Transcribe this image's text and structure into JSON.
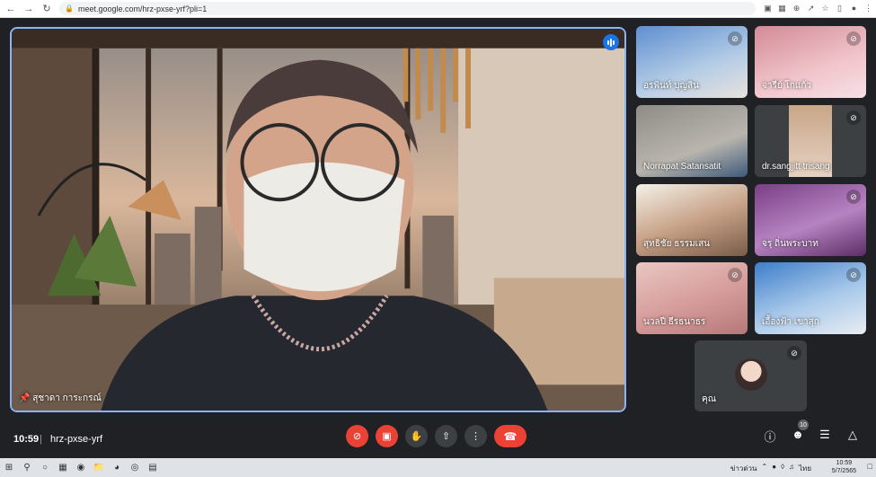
{
  "browser": {
    "url": "meet.google.com/hrz-pxse-yrf?pli=1",
    "back_icon": "arrow-left-icon",
    "forward_icon": "arrow-right-icon",
    "reload_icon": "reload-icon"
  },
  "main_speaker": {
    "name": "สุชาดา การะกรณ์"
  },
  "participants": [
    {
      "name": "อรพินท์ บุญสิน",
      "muted": true
    },
    {
      "name": "จารีย์ โกแก้ว",
      "muted": true
    },
    {
      "name": "Norrapat Satansatit",
      "muted": false
    },
    {
      "name": "dr.sangjitt trisang",
      "muted": true
    },
    {
      "name": "สุทธิชัย ธรรมเสน",
      "muted": false
    },
    {
      "name": "จรุ ถิ่นพระบาท",
      "muted": true
    },
    {
      "name": "นวลปี ธีรธนาธร",
      "muted": true
    },
    {
      "name": "เอื้องฟ้า เขาสุก",
      "muted": true
    }
  ],
  "self_tile": {
    "name": "คุณ",
    "muted": true
  },
  "bottom_bar": {
    "time": "10:59",
    "separator": "|",
    "meeting_code": "hrz-pxse-yrf",
    "participant_count": "10"
  },
  "taskbar": {
    "language": "ไทย",
    "weather": "ข่าวด่วน",
    "time": "10:59",
    "date": "5/7/2565"
  },
  "colors": {
    "accent": "#8ab4f8",
    "danger": "#ea4335",
    "background": "#202124"
  }
}
